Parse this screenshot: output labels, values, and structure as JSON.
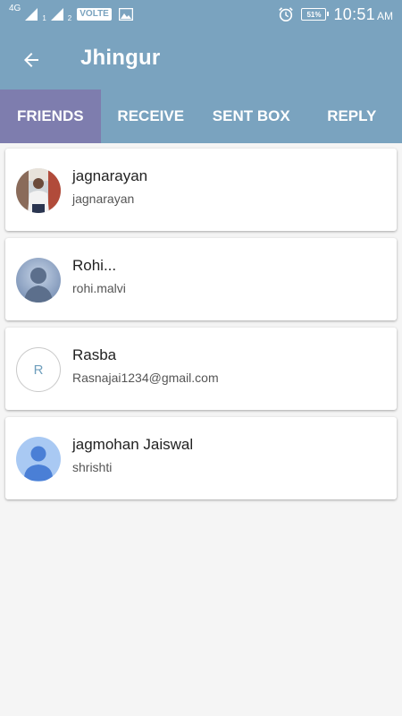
{
  "status_bar": {
    "network_label": "4G",
    "sim1_label": "1",
    "sim2_label": "2",
    "volte_label": "VOLTE",
    "battery_label": "51%",
    "time": "10:51",
    "ampm": "AM",
    "icons": [
      "signal-icon",
      "gallery-icon",
      "alarm-icon",
      "battery-icon"
    ]
  },
  "toolbar": {
    "back_icon": "arrow-back-icon",
    "title": "Jhingur"
  },
  "tabs": [
    {
      "label": "FRIENDS",
      "active": true
    },
    {
      "label": "RECEIVE",
      "active": false
    },
    {
      "label": "SENT BOX",
      "active": false
    },
    {
      "label": "REPLY",
      "active": false
    }
  ],
  "friends": [
    {
      "name": "jagnarayan",
      "username": "jagnarayan",
      "avatar": "photo"
    },
    {
      "name": "Rohi...",
      "username": "rohi.malvi",
      "avatar": "silhouette"
    },
    {
      "name": "Rasba",
      "username": "Rasnajai1234@gmail.com",
      "avatar": "letter",
      "avatar_letter": "R"
    },
    {
      "name": "jagmohan Jaiswal",
      "username": "shrishti",
      "avatar": "default-person"
    }
  ],
  "colors": {
    "app_bar": "#7aa3bf",
    "active_tab": "#7e7dae",
    "background": "#f5f5f5",
    "card": "#ffffff"
  }
}
